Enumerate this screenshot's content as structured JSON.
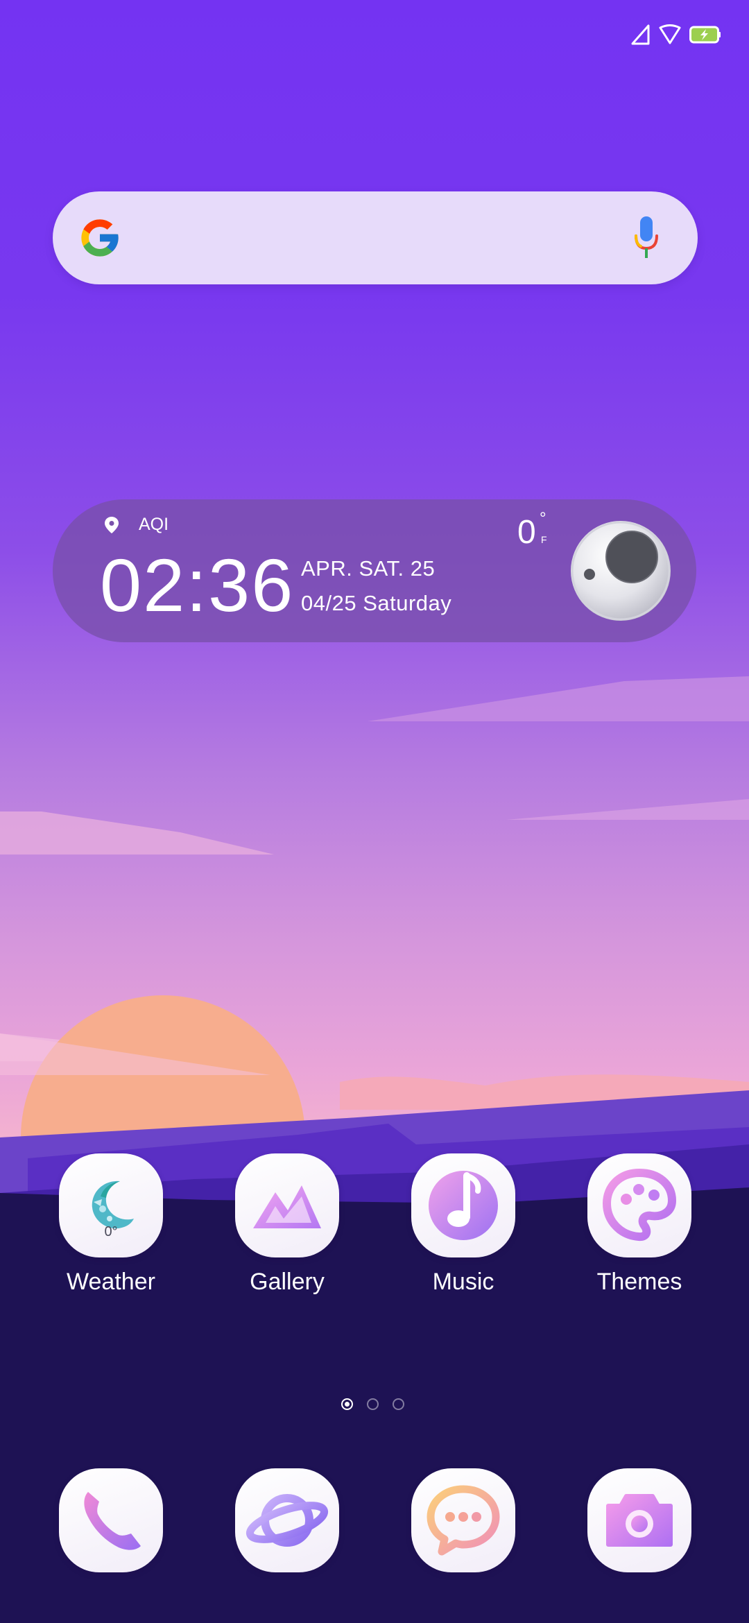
{
  "status_bar": {
    "icons": [
      "signal-icon",
      "wifi-icon",
      "battery-charging-icon"
    ],
    "battery_color": "#9ccf4f"
  },
  "search": {
    "logo": "google-g-icon",
    "voice": "mic-icon"
  },
  "clock_widget": {
    "aqi_label": "AQI",
    "time": "02:36",
    "date_line1": "APR.  SAT.  25",
    "date_line2": "04/25  Saturday",
    "temperature": "0",
    "degree_symbol": "°",
    "temperature_unit": "F"
  },
  "apps": [
    {
      "label": "Weather",
      "icon": "weather-moon-icon",
      "sub": "0°"
    },
    {
      "label": "Gallery",
      "icon": "gallery-mountain-icon"
    },
    {
      "label": "Music",
      "icon": "music-note-icon"
    },
    {
      "label": "Themes",
      "icon": "palette-icon"
    }
  ],
  "pages": {
    "total": 3,
    "current": 1
  },
  "dock": [
    {
      "icon": "phone-icon"
    },
    {
      "icon": "browser-planet-icon"
    },
    {
      "icon": "messages-icon"
    },
    {
      "icon": "camera-icon"
    }
  ],
  "colors": {
    "wallpaper_top": "#7433f2",
    "wallpaper_bottom": "#1e1254",
    "sun": "#f7ad8e",
    "accent_purple": "#b47cf5"
  }
}
